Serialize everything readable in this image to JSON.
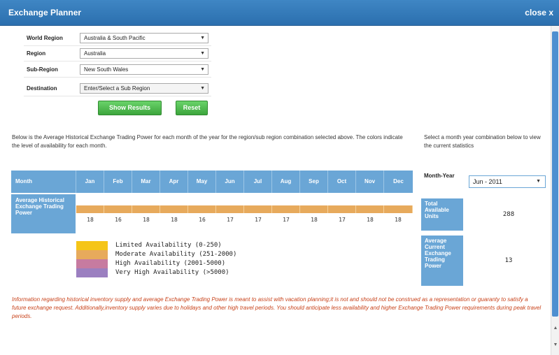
{
  "window": {
    "title": "Exchange Planner",
    "close_label": "close x"
  },
  "form": {
    "fields": [
      {
        "label": "World Region",
        "value": "Australia & South Pacific"
      },
      {
        "label": "Region",
        "value": "Australia"
      },
      {
        "label": "Sub-Region",
        "value": "New South Wales"
      },
      {
        "label": "Destination",
        "value": "Enter/Select a Sub Region"
      }
    ],
    "show_results_label": "Show Results",
    "reset_label": "Reset"
  },
  "intro_text": "Below is the Average Historical Exchange Trading Power for each month of the year for the region/sub region combination selected above. The colors indicate the level of availability for each month.",
  "side_text": "Select a month year combination below to view the current statistics",
  "table": {
    "month_header": "Month",
    "months": [
      "Jan",
      "Feb",
      "Mar",
      "Apr",
      "May",
      "Jun",
      "Jul",
      "Aug",
      "Sep",
      "Oct",
      "Nov",
      "Dec"
    ],
    "avg_label": "Average Historical Exchange Trading Power",
    "values": [
      "18",
      "16",
      "18",
      "18",
      "16",
      "17",
      "17",
      "17",
      "18",
      "17",
      "18",
      "18"
    ],
    "bar_color": "#e7aa5c"
  },
  "legend": [
    {
      "label": "Limited Availability (0-250)",
      "color": "#f5c518"
    },
    {
      "label": "Moderate Availability (251-2000)",
      "color": "#e7aa5c"
    },
    {
      "label": "High Availability (2001-5000)",
      "color": "#c77ba0"
    },
    {
      "label": "Very High Availability (>5000)",
      "color": "#9b7fc0"
    }
  ],
  "stats": {
    "month_year_label": "Month-Year",
    "month_year_value": "Jun - 2011",
    "total_label": "Total Available Units",
    "total_value": "288",
    "avg_current_label": "Average Current Exchange Trading Power",
    "avg_current_value": "13"
  },
  "disclaimer": "Information regarding historical inventory supply and average Exchange Trading Power is meant to assist with vacation planning;it is not and should not be construed as a representation or guaranty to satisfy a future exchange request. Additionally,inventory supply varies due to holidays and other high travel periods. You should anticipate less availability and higher Exchange Trading Power requirements during peak travel periods."
}
